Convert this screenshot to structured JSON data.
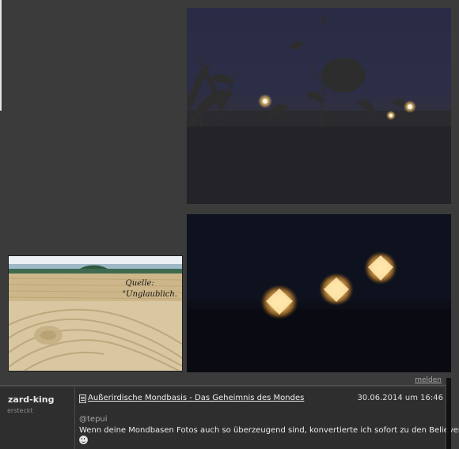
{
  "images": {
    "field_caption_source": "Quelle:",
    "field_caption_title": "\"Unglaublich."
  },
  "post": {
    "report_label": "melden",
    "username": "zard-king",
    "user_status": "ersteckt",
    "topic_title": "Außerirdische Mondbasis - Das Geheimnis des Mondes",
    "date": "30.06.2014 um 16:46",
    "mention": "@tepui",
    "message": "Wenn deine Mondbasen Fotos auch so überzeugend sind, konvertierte ich sofort zu den Believern!!!"
  },
  "icons": {
    "topic_icon": "document-icon",
    "smiley": "smiley-icon"
  },
  "colors": {
    "page_background": "#3b3b3b",
    "post_background": "#2e2e2e",
    "text_primary": "#ececec",
    "text_muted": "#a8a8a8"
  }
}
